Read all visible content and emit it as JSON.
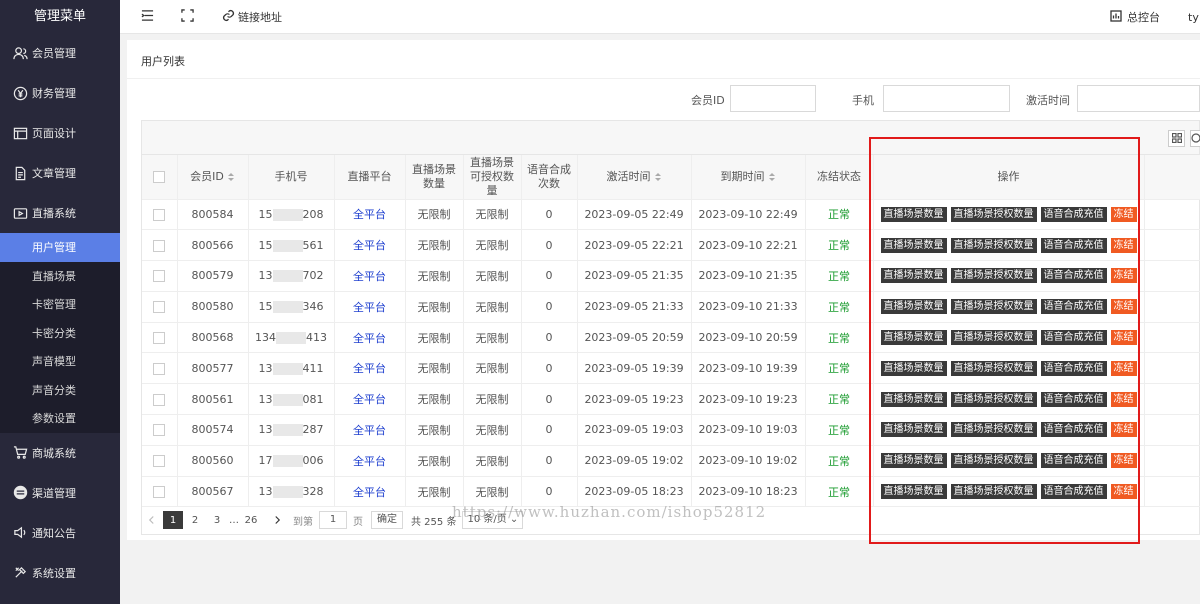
{
  "sidebar": {
    "title": "管理菜单",
    "items": [
      {
        "label": "会员管理",
        "icon": "users-icon"
      },
      {
        "label": "财务管理",
        "icon": "yen-icon"
      },
      {
        "label": "页面设计",
        "icon": "layout-icon"
      },
      {
        "label": "文章管理",
        "icon": "document-icon"
      },
      {
        "label": "直播系统",
        "icon": "video-icon"
      }
    ],
    "subitems": [
      {
        "label": "用户管理",
        "active": true
      },
      {
        "label": "直播场景"
      },
      {
        "label": "卡密管理"
      },
      {
        "label": "卡密分类"
      },
      {
        "label": "声音模型"
      },
      {
        "label": "声音分类"
      },
      {
        "label": "参数设置"
      }
    ],
    "items_after": [
      {
        "label": "商城系统",
        "icon": "cart-icon"
      },
      {
        "label": "渠道管理",
        "icon": "channel-icon"
      },
      {
        "label": "通知公告",
        "icon": "speaker-icon"
      },
      {
        "label": "系统设置",
        "icon": "settings-icon"
      }
    ]
  },
  "topbar": {
    "link_label": "链接地址",
    "dashboard_label": "总控台",
    "user_label": "ty"
  },
  "page_title": "用户列表",
  "search": {
    "member_id_label": "会员ID",
    "phone_label": "手机",
    "activate_label": "激活时间"
  },
  "table": {
    "headers": {
      "member_id": "会员ID",
      "phone": "手机号",
      "platform": "直播平台",
      "scene_count": "直播场景数量",
      "scene_auth": "直播场景可授权数量",
      "tts_count": "语音合成次数",
      "activate": "激活时间",
      "expire": "到期时间",
      "status": "冻结状态",
      "actions": "操作"
    },
    "action_labels": {
      "scene_count": "直播场景数量",
      "scene_auth": "直播场景授权数量",
      "tts": "语音合成充值",
      "freeze": "冻结"
    },
    "rows": [
      {
        "id": "800584",
        "phone_pre": "15",
        "phone_suf": "208",
        "platform": "全平台",
        "scenes": "无限制",
        "auth": "无限制",
        "tts": "0",
        "activate": "2023-09-05 22:49",
        "expire": "2023-09-10 22:49",
        "status": "正常"
      },
      {
        "id": "800566",
        "phone_pre": "15",
        "phone_suf": "561",
        "platform": "全平台",
        "scenes": "无限制",
        "auth": "无限制",
        "tts": "0",
        "activate": "2023-09-05 22:21",
        "expire": "2023-09-10 22:21",
        "status": "正常"
      },
      {
        "id": "800579",
        "phone_pre": "13",
        "phone_suf": "702",
        "platform": "全平台",
        "scenes": "无限制",
        "auth": "无限制",
        "tts": "0",
        "activate": "2023-09-05 21:35",
        "expire": "2023-09-10 21:35",
        "status": "正常"
      },
      {
        "id": "800580",
        "phone_pre": "15",
        "phone_suf": "346",
        "platform": "全平台",
        "scenes": "无限制",
        "auth": "无限制",
        "tts": "0",
        "activate": "2023-09-05 21:33",
        "expire": "2023-09-10 21:33",
        "status": "正常"
      },
      {
        "id": "800568",
        "phone_pre": "134",
        "phone_suf": "413",
        "platform": "全平台",
        "scenes": "无限制",
        "auth": "无限制",
        "tts": "0",
        "activate": "2023-09-05 20:59",
        "expire": "2023-09-10 20:59",
        "status": "正常"
      },
      {
        "id": "800577",
        "phone_pre": "13",
        "phone_suf": "411",
        "platform": "全平台",
        "scenes": "无限制",
        "auth": "无限制",
        "tts": "0",
        "activate": "2023-09-05 19:39",
        "expire": "2023-09-10 19:39",
        "status": "正常"
      },
      {
        "id": "800561",
        "phone_pre": "13",
        "phone_suf": "081",
        "platform": "全平台",
        "scenes": "无限制",
        "auth": "无限制",
        "tts": "0",
        "activate": "2023-09-05 19:23",
        "expire": "2023-09-10 19:23",
        "status": "正常"
      },
      {
        "id": "800574",
        "phone_pre": "13",
        "phone_suf": "287",
        "platform": "全平台",
        "scenes": "无限制",
        "auth": "无限制",
        "tts": "0",
        "activate": "2023-09-05 19:03",
        "expire": "2023-09-10 19:03",
        "status": "正常"
      },
      {
        "id": "800560",
        "phone_pre": "17",
        "phone_suf": "006",
        "platform": "全平台",
        "scenes": "无限制",
        "auth": "无限制",
        "tts": "0",
        "activate": "2023-09-05 19:02",
        "expire": "2023-09-10 19:02",
        "status": "正常"
      },
      {
        "id": "800567",
        "phone_pre": "13",
        "phone_suf": "328",
        "platform": "全平台",
        "scenes": "无限制",
        "auth": "无限制",
        "tts": "0",
        "activate": "2023-09-05 18:23",
        "expire": "2023-09-10 18:23",
        "status": "正常"
      }
    ]
  },
  "pager": {
    "pages": [
      "1",
      "2",
      "3",
      "…",
      "26"
    ],
    "goto_label": "到第",
    "goto_value": "1",
    "page_unit": "页",
    "confirm_label": "确定",
    "total_label": "共 255 条",
    "page_size": "10 条/页"
  },
  "watermark": "https://www.huzhan.com/ishop52812",
  "colors": {
    "sidebar_bg": "#28283a",
    "active": "#5b7fe6",
    "freeze": "#f05a22",
    "status": "#1a9b2e",
    "platform": "#1e3fcf",
    "highlight": "#e11a1a"
  }
}
